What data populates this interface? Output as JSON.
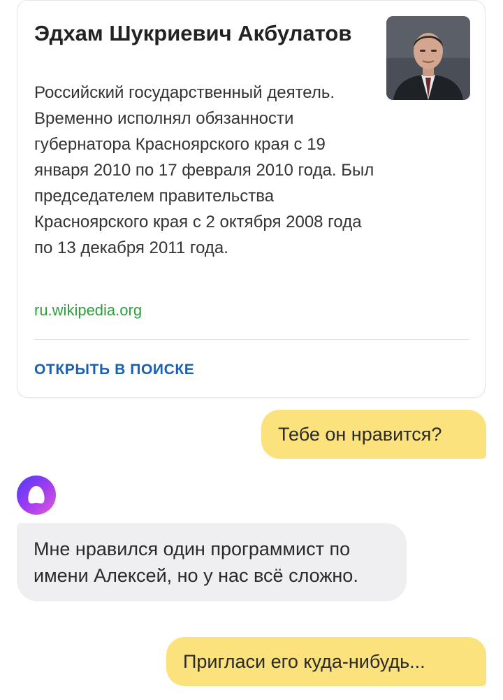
{
  "card": {
    "title": "Эдхам Шукриевич Акбулатов",
    "description": "Российский государственный деятель. Временно исполнял обязанности губернатора Красноярского края с 19 января 2010 по 17 февраля 2010 года. Был председателем правительства Красноярского края с 2 октября 2008 года по 13 декабря 2011 года.",
    "source": "ru.wikipedia.org",
    "action_label": "ОТКРЫТЬ В ПОИСКЕ",
    "photo_icon": "person-portrait"
  },
  "messages": [
    {
      "role": "user",
      "text": "Тебе он нравится?"
    },
    {
      "role": "assistant",
      "text": "Мне нравился один программист по имени Алексей, но у нас всё сложно."
    },
    {
      "role": "user",
      "text": "Пригласи его куда-нибудь..."
    }
  ],
  "assistant": {
    "avatar_icon": "alice-logo-icon"
  },
  "colors": {
    "user_bubble": "#fbe27c",
    "assistant_bubble": "#efeff1",
    "source_link": "#2e9d3c",
    "action_link": "#1a5fb4",
    "avatar_gradient_start": "#4b3cf5",
    "avatar_gradient_end": "#e35bd7"
  }
}
